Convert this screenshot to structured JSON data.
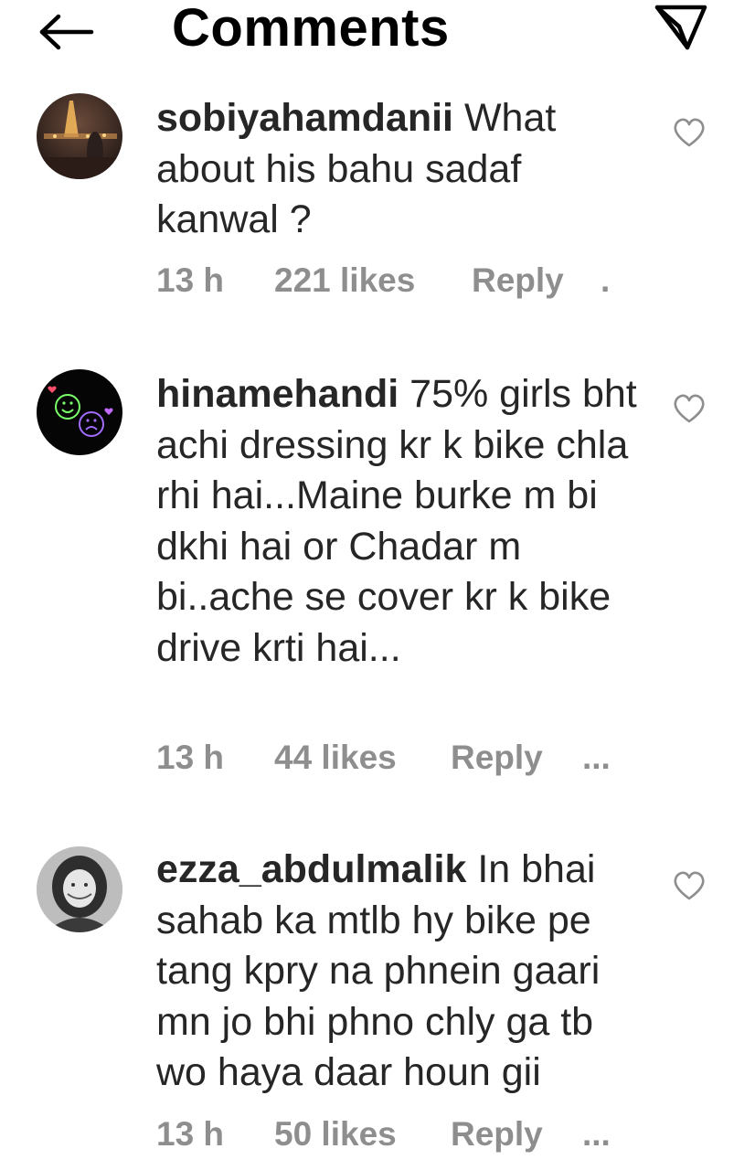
{
  "header": {
    "title": "Comments",
    "back_icon": "arrow-left-icon",
    "send_icon": "paper-plane-icon"
  },
  "comments": [
    {
      "username": "sobiyahamdanii",
      "text": "What about his bahu sadaf kanwal ?",
      "time": "13 h",
      "likes": "221 likes",
      "reply": "Reply",
      "more": "."
    },
    {
      "username": "hinamehandi",
      "text": "75% girls bht achi dressing kr k bike chla rhi hai...Maine burke m bi dkhi hai or Chadar m bi..ache se cover kr k bike drive krti hai...",
      "time": "13 h",
      "likes": "44 likes",
      "reply": "Reply",
      "more": "..."
    },
    {
      "username": "ezza_abdulmalik",
      "text": "In bhai sahab ka mtlb hy bike pe tang kpry na phnein gaari mn jo bhi phno chly ga tb wo haya daar houn gii",
      "time": "13 h",
      "likes": "50 likes",
      "reply": "Reply",
      "more": "..."
    }
  ],
  "colors": {
    "text": "#262626",
    "secondary": "#8e8e8e",
    "background": "#ffffff"
  }
}
